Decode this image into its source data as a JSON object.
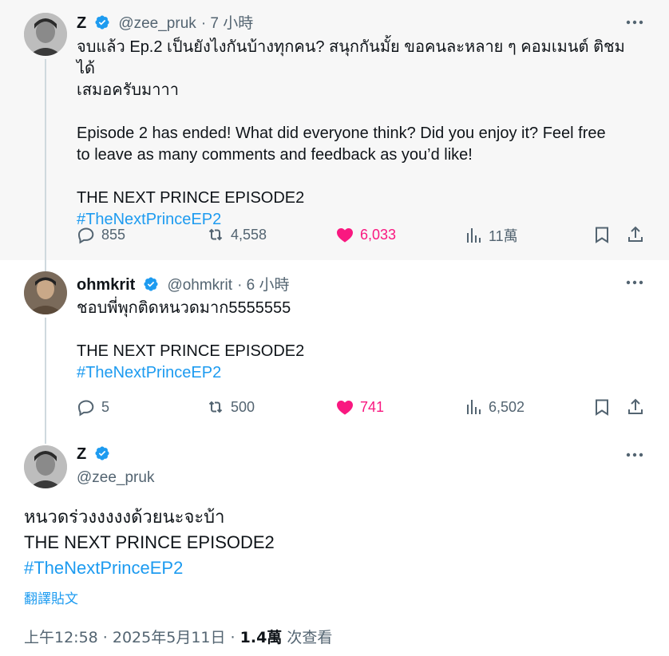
{
  "tweets": [
    {
      "name": "Z",
      "handle": "@zee_pruk",
      "time": "· 7 小時",
      "lines": [
        "จบแล้ว Ep.2 เป็นยังไงกันบ้างทุกคน? สนุกกันมั้ย ขอคนละหลาย ๆ คอมเมนต์ ติชมได้",
        "เสมอครับมาาา",
        "",
        "Episode 2 has ended! What did everyone think? Did you enjoy it? Feel free",
        "to leave as many comments and feedback as you’d like!",
        "",
        "THE NEXT PRINCE EPISODE2"
      ],
      "hashtag": "#TheNextPrinceEP2",
      "replies": "855",
      "retweets": "4,558",
      "likes": "6,033",
      "views": "11萬"
    },
    {
      "name": "ohmkrit",
      "handle": "@ohmkrit",
      "time": "· 6 小時",
      "lines": [
        "ชอบพี่พุกติดหนวดมาก5555555",
        "",
        "THE NEXT PRINCE EPISODE2"
      ],
      "hashtag": "#TheNextPrinceEP2",
      "replies": "5",
      "retweets": "500",
      "likes": "741",
      "views": "6,502"
    }
  ],
  "main": {
    "name": "Z",
    "handle": "@zee_pruk",
    "line1": "หนวดร่วงงงงงด้วยนะจะบ้า",
    "line2": "THE NEXT PRINCE EPISODE2",
    "hashtag": "#TheNextPrinceEP2",
    "translate": "翻譯貼文",
    "time": "上午12:58 · 2025年5月11日 ·",
    "views": "1.4萬",
    "views_suffix": "次查看"
  },
  "colors": {
    "accent": "#1d9bf0",
    "like": "#f91880",
    "muted": "#536471"
  },
  "icons": [
    "verified-icon",
    "more-icon",
    "reply-icon",
    "retweet-icon",
    "heart-icon",
    "views-icon",
    "bookmark-icon",
    "share-icon"
  ]
}
